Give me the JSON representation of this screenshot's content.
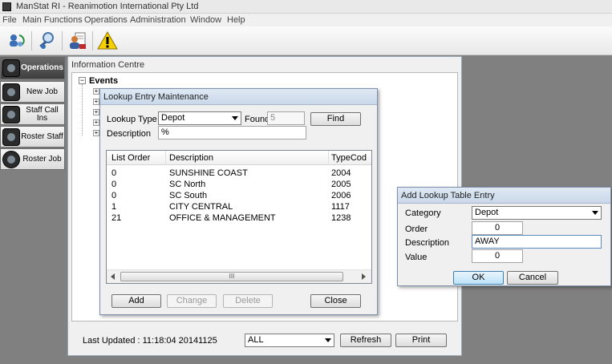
{
  "window": {
    "title": "ManStat RI - Reanimotion International Pty Ltd"
  },
  "menu": [
    "File",
    "Main Functions",
    "Operations",
    "Administration",
    "Window",
    "Help"
  ],
  "toolbar": {
    "icons": [
      "refresh-users-icon",
      "search-icon",
      "user-report-icon",
      "warning-icon"
    ],
    "colors": {
      "warning": "#f5d000"
    }
  },
  "sidebar": {
    "items": [
      {
        "label": "Operations",
        "icon": "operations-icon"
      },
      {
        "label": "New Job",
        "icon": "new-job-icon"
      },
      {
        "label": "Staff Call Ins",
        "icon": "staff-call-ins-icon"
      },
      {
        "label": "Roster Staff",
        "icon": "roster-staff-icon"
      },
      {
        "label": "Roster Job",
        "icon": "roster-job-icon"
      }
    ]
  },
  "info_centre": {
    "title": "Information Centre",
    "tree_root": "Events",
    "last_updated": "Last Updated : 11:18:04 20141125",
    "filter_value": "ALL",
    "refresh_label": "Refresh",
    "print_label": "Print"
  },
  "lookup_dialog": {
    "title": "Lookup Entry Maintenance",
    "lookup_type_label": "Lookup Type",
    "lookup_type_value": "Depot",
    "found_label": "Found",
    "found_value": "5",
    "find_label": "Find",
    "description_label": "Description",
    "description_value": "%",
    "columns": [
      "List Order",
      "Description",
      "TypeCod"
    ],
    "rows": [
      {
        "order": "0",
        "description": "SUNSHINE COAST",
        "code": "2004"
      },
      {
        "order": "0",
        "description": "SC North",
        "code": "2005"
      },
      {
        "order": "0",
        "description": "SC South",
        "code": "2006"
      },
      {
        "order": "1",
        "description": "CITY CENTRAL",
        "code": "1117"
      },
      {
        "order": "21",
        "description": "OFFICE & MANAGEMENT",
        "code": "1238"
      }
    ],
    "scroll_grip": "III",
    "add_label": "Add",
    "change_label": "Change",
    "delete_label": "Delete",
    "close_label": "Close"
  },
  "add_dialog": {
    "title": "Add Lookup Table Entry",
    "category_label": "Category",
    "category_value": "Depot",
    "order_label": "Order",
    "order_value": "0",
    "description_label": "Description",
    "description_value": "AWAY",
    "value_label": "Value",
    "value_value": "0",
    "ok_label": "OK",
    "cancel_label": "Cancel"
  }
}
